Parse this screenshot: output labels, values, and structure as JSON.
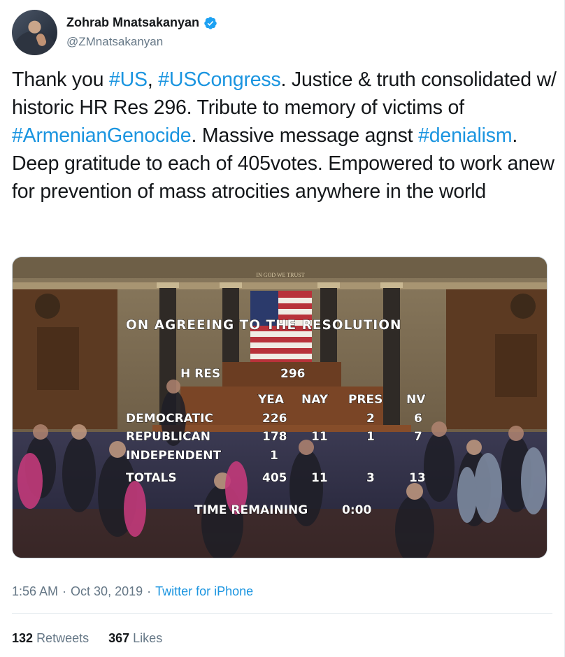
{
  "user": {
    "display_name": "Zohrab Mnatsakanyan",
    "handle": "@ZMnatsakanyan",
    "verified": true
  },
  "tweet": {
    "segments": [
      {
        "text": "Thank you ",
        "type": "text"
      },
      {
        "text": "#US",
        "type": "hashtag"
      },
      {
        "text": ", ",
        "type": "text"
      },
      {
        "text": "#USCongress",
        "type": "hashtag"
      },
      {
        "text": ". Justice & truth consolidated w/ historic HR Res 296. Tribute to memory of victims of ",
        "type": "text"
      },
      {
        "text": "#ArmenianGenocide",
        "type": "hashtag"
      },
      {
        "text": ". Massive message agnst ",
        "type": "text"
      },
      {
        "text": "#denialism",
        "type": "hashtag"
      },
      {
        "text": ". Deep gratitude to each of 405votes. Empowered to work anew for prevention of mass atrocities anywhere in the world",
        "type": "text"
      }
    ]
  },
  "media": {
    "inscription": "IN GOD WE TRUST",
    "title": "ON AGREEING TO THE RESOLUTION",
    "measure_label": "H RES",
    "measure_number": "296",
    "columns": [
      "YEA",
      "NAY",
      "PRES",
      "NV"
    ],
    "rows": [
      {
        "party": "DEMOCRATIC",
        "yea": "226",
        "nay": "",
        "pres": "2",
        "nv": "6"
      },
      {
        "party": "REPUBLICAN",
        "yea": "178",
        "nay": "11",
        "pres": "1",
        "nv": "7"
      },
      {
        "party": "INDEPENDENT",
        "yea": "1",
        "nay": "",
        "pres": "",
        "nv": ""
      },
      {
        "party": "TOTALS",
        "yea": "405",
        "nay": "11",
        "pres": "3",
        "nv": "13"
      }
    ],
    "time_label": "TIME REMAINING",
    "time_value": "0:00"
  },
  "meta": {
    "time": "1:56 AM",
    "separator": "·",
    "date": "Oct 30, 2019",
    "source": "Twitter for iPhone"
  },
  "stats": {
    "retweets_count": "132",
    "retweets_label": "Retweets",
    "likes_count": "367",
    "likes_label": "Likes"
  },
  "colors": {
    "link": "#1b95e0",
    "verified": "#1da1f2",
    "text": "#14171a",
    "secondary": "#657786"
  },
  "icons": {
    "verified": "verified-badge-icon"
  }
}
